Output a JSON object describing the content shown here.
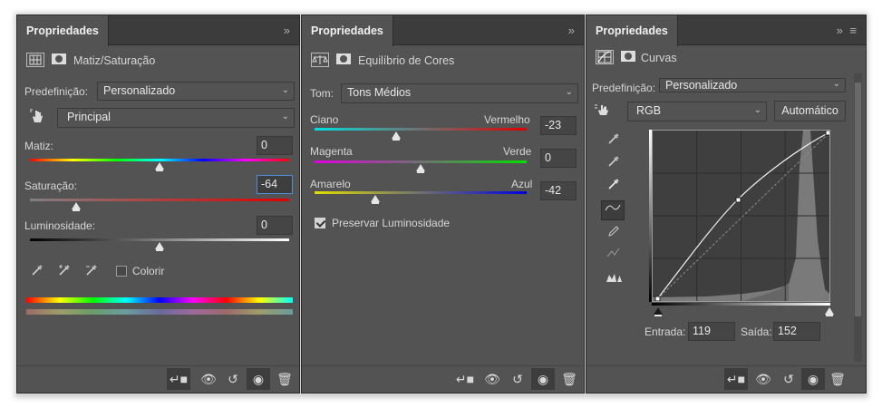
{
  "hue_panel": {
    "tab_title": "Propriedades",
    "panel_icons": "» ",
    "adjustment_title": "Matiz/Saturação",
    "preset_label": "Predefinição:",
    "preset_value": "Personalizado",
    "channel_value": "Principal",
    "hue_label": "Matiz:",
    "hue_value": "0",
    "saturation_label": "Saturação:",
    "saturation_value": "-64",
    "lightness_label": "Luminosidade:",
    "lightness_value": "0",
    "colorize_label": "Colorir",
    "colorize_checked": false
  },
  "color_balance_panel": {
    "tab_title": "Propriedades",
    "panel_icons": "» ",
    "adjustment_title": "Equilíbrio de Cores",
    "tone_label": "Tom:",
    "tone_value": "Tons Médios",
    "cyan_label": "Ciano",
    "red_label": "Vermelho",
    "cyan_red_value": "-23",
    "magenta_label": "Magenta",
    "green_label": "Verde",
    "magenta_green_value": "0",
    "yellow_label": "Amarelo",
    "blue_label": "Azul",
    "yellow_blue_value": "-42",
    "preserve_label": "Preservar Luminosidade",
    "preserve_checked": true
  },
  "curves_panel": {
    "tab_title": "Propriedades",
    "panel_icons": "» ≡",
    "adjustment_title": "Curvas",
    "preset_label": "Predefinição:",
    "preset_value": "Personalizado",
    "channel_value": "RGB",
    "auto_button": "Automático",
    "input_label": "Entrada:",
    "input_value": "119",
    "output_label": "Saída:",
    "output_value": "152"
  },
  "icons": {
    "hue_footer": [
      "clip-icon",
      "view-previous-icon",
      "reset-icon",
      "visibility-icon",
      "trash-icon"
    ],
    "eyedroppers": [
      "eyedropper-icon",
      "eyedropper-add-icon",
      "eyedropper-subtract-icon"
    ],
    "curves_tools": [
      "black-point-eyedropper-icon",
      "gray-point-eyedropper-icon",
      "white-point-eyedropper-icon",
      "curve-edit-icon",
      "pencil-icon",
      "smooth-icon",
      "clipping-warning-icon"
    ]
  },
  "colors": {
    "panel_bg": "#535353",
    "tab_bar_bg": "#3c3c3c",
    "input_focus": "#4b8fd8"
  }
}
